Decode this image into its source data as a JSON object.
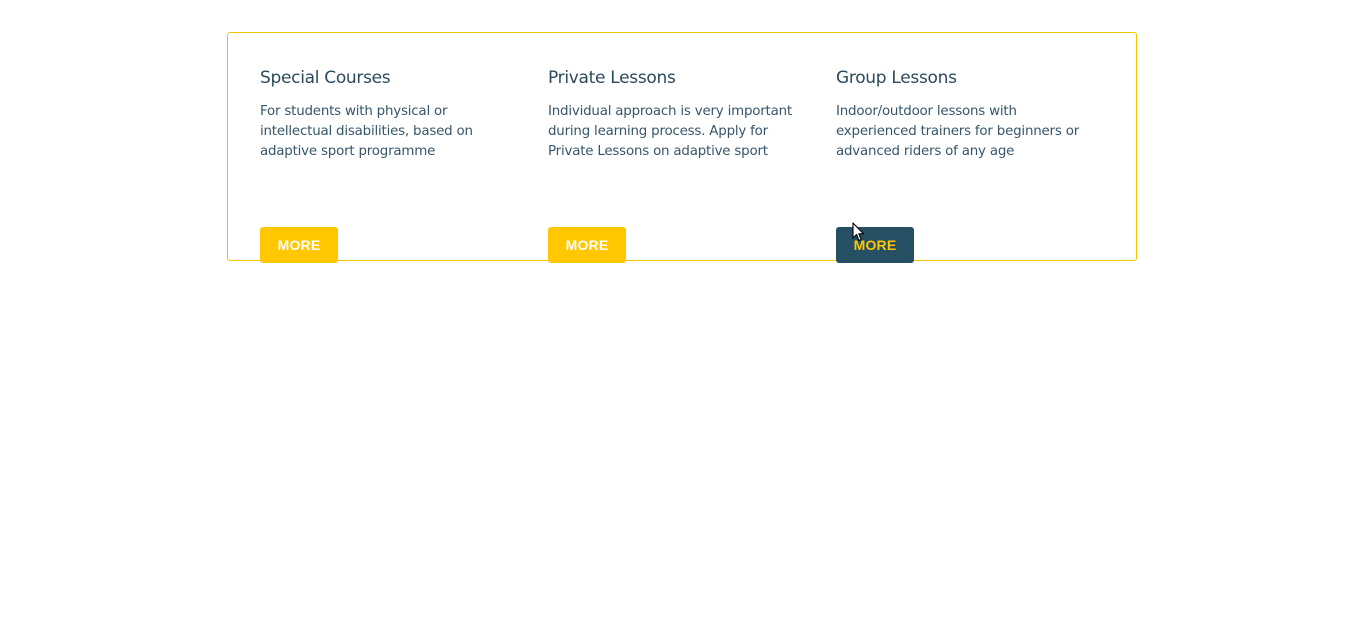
{
  "services": [
    {
      "title": "Special Courses",
      "description": "For students with physical or intellectual disabilities, based on adaptive sport programme",
      "button_label": "MORE"
    },
    {
      "title": "Private Lessons",
      "description": "Individual approach is very important during learning process. Apply for Private Lessons on adaptive sport",
      "button_label": "MORE"
    },
    {
      "title": "Group Lessons",
      "description": "Indoor/outdoor lessons with experienced trainers for beginners or advanced riders of any age",
      "button_label": "MORE"
    }
  ],
  "colors": {
    "accent": "#ffc700",
    "primary_dark": "#274f63",
    "text": "#2b4a5c",
    "border": "#f5c400"
  },
  "icons": {
    "cursor": "mouse-pointer-icon"
  }
}
